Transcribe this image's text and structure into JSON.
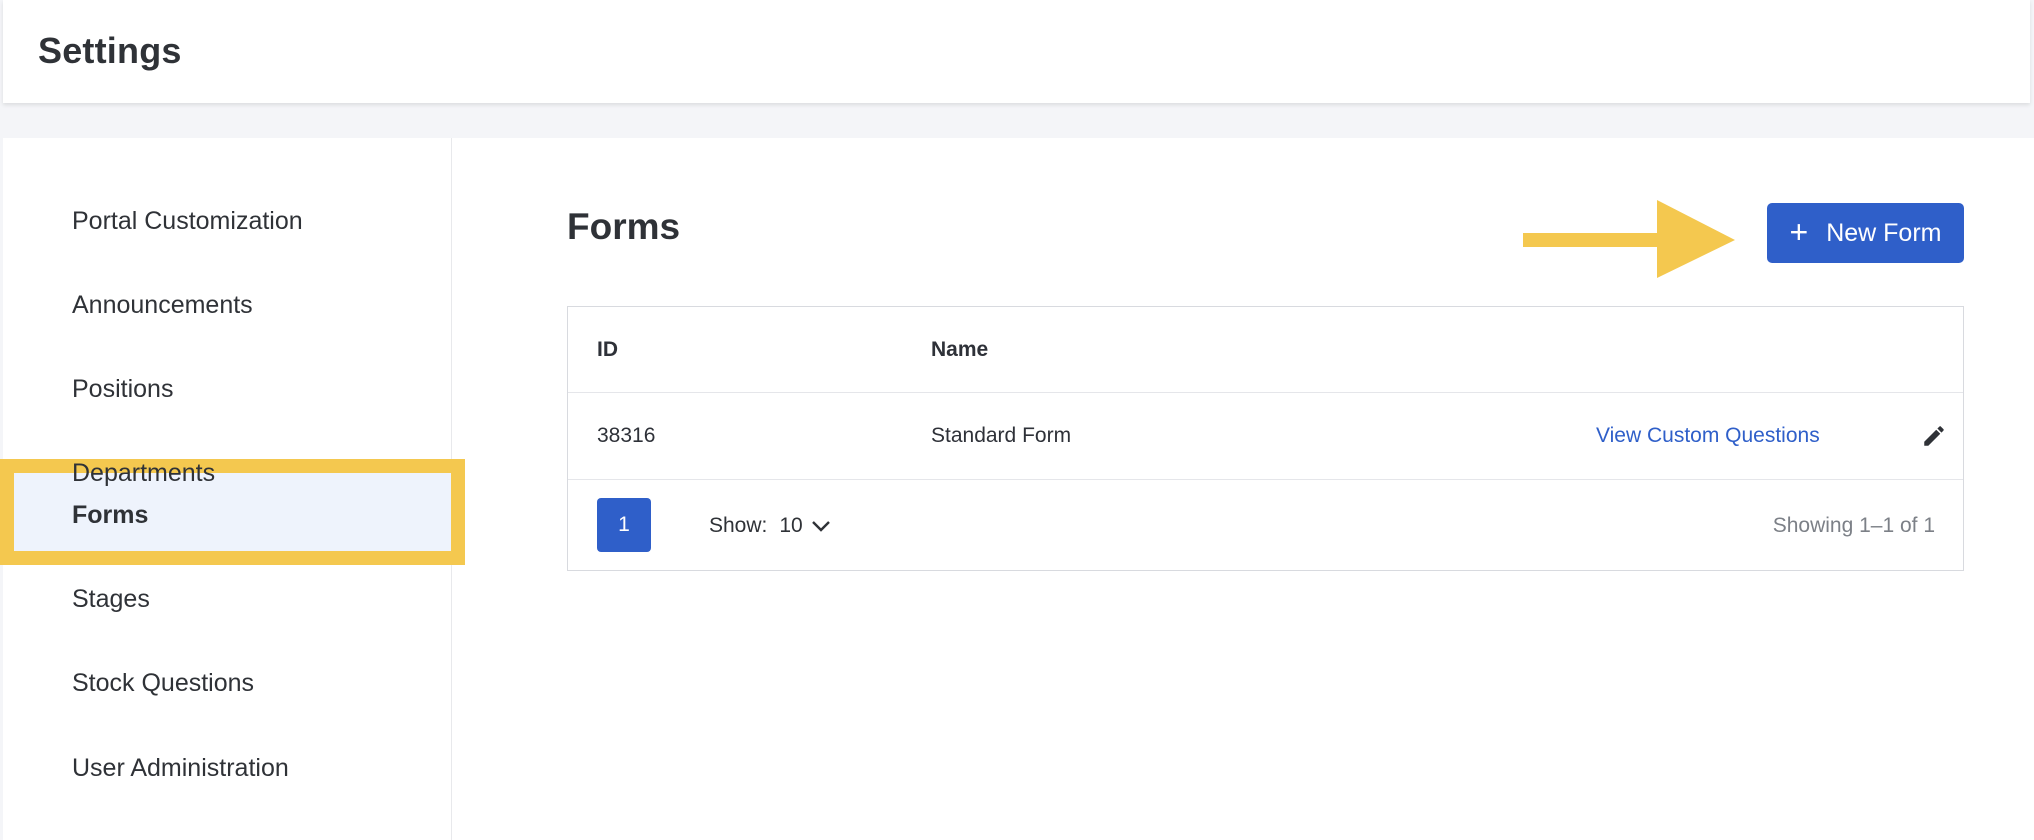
{
  "header": {
    "title": "Settings"
  },
  "sidebar": {
    "items": [
      {
        "label": "Portal Customization"
      },
      {
        "label": "Announcements"
      },
      {
        "label": "Positions"
      },
      {
        "label": "Departments"
      },
      {
        "label": "Forms"
      },
      {
        "label": "Stages"
      },
      {
        "label": "Stock Questions"
      },
      {
        "label": "User Administration"
      }
    ],
    "active_index": 4
  },
  "main": {
    "title": "Forms",
    "new_form_label": "New Form",
    "table": {
      "headers": [
        "ID",
        "Name"
      ],
      "rows": [
        {
          "id": "38316",
          "name": "Standard Form",
          "link": "View Custom Questions"
        }
      ]
    },
    "pagination": {
      "current_page": "1",
      "show_label": "Show:",
      "page_size": "10",
      "showing_text": "Showing 1–1 of 1"
    }
  },
  "colors": {
    "accent": "#2f5fc9",
    "highlight": "#f4c84f",
    "active_bg": "#eef3fc"
  },
  "icons": {
    "plus": "plus-icon",
    "pencil": "pencil-icon",
    "chevron": "chevron-down-icon",
    "arrow": "annotation-arrow"
  }
}
